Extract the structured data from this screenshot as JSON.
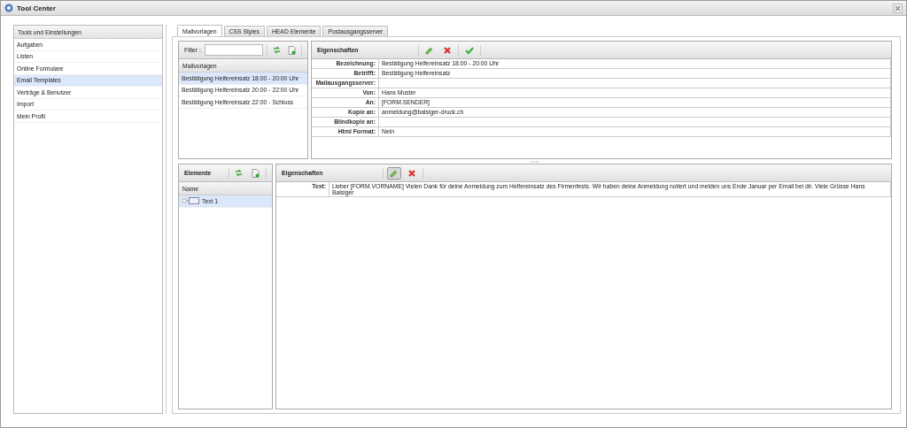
{
  "window": {
    "title": "Tool Center"
  },
  "sidebar": {
    "header": "Tools und Einstellungen",
    "items": [
      {
        "label": "Aufgaben",
        "selected": false
      },
      {
        "label": "Listen",
        "selected": false
      },
      {
        "label": "Online Formulare",
        "selected": false
      },
      {
        "label": "Email Templates",
        "selected": true
      },
      {
        "label": "Verträge & Benutzer",
        "selected": false
      },
      {
        "label": "Import",
        "selected": false
      },
      {
        "label": "Mein Profil",
        "selected": false
      }
    ]
  },
  "tabs": [
    {
      "label": "Mailvorlagen",
      "selected": true
    },
    {
      "label": "CSS Styles",
      "selected": false
    },
    {
      "label": "HEAD Elemente",
      "selected": false
    },
    {
      "label": "Postausgangsserver",
      "selected": false
    }
  ],
  "templates": {
    "filter_label": "Filter :",
    "toolbar": [
      {
        "kind": "refresh"
      },
      {
        "kind": "add"
      }
    ],
    "header": "Mailvorlagen",
    "rows": [
      {
        "label": "Bestätigung Helfereinsatz 18:00 - 20:00 Uhr",
        "selected": true
      },
      {
        "label": "Bestätigung Helfereinsatz 20:00 - 22:00 Uhr",
        "selected": false
      },
      {
        "label": "Bestätigung Helfereinsatz 22:00 - Schluss",
        "selected": false
      }
    ]
  },
  "properties": {
    "title": "Eigenschaften",
    "toolbar": [
      {
        "kind": "edit",
        "pressed": false
      },
      {
        "kind": "delete",
        "pressed": false
      },
      {
        "kind": "save",
        "pressed": false
      }
    ],
    "rows": [
      {
        "label": "Bezeichnung:",
        "value": "Bestätigung Helfereinsatz 18:00 - 20:00 Uhr"
      },
      {
        "label": "Betrifft:",
        "value": "Bestätigung Helfereinsatz"
      },
      {
        "label": "Mailausgangsserver:"
      },
      {
        "label": "Von:",
        "value": "Hans Muster"
      },
      {
        "label": "An:",
        "value": "[FORM.SENDER]"
      },
      {
        "label": "Kopie an:",
        "value": "anmeldung@balsiger-druck.ch"
      },
      {
        "label": "Blindkopie an:"
      },
      {
        "label": "Html Format:",
        "value": "Nein"
      }
    ]
  },
  "elements": {
    "title": "Elemente",
    "toolbar": [
      {
        "kind": "refresh"
      },
      {
        "kind": "add"
      }
    ],
    "column": "Name",
    "items": [
      {
        "label": "Text 1",
        "selected": true
      }
    ]
  },
  "element_properties": {
    "title": "Eigenschaften",
    "toolbar": [
      {
        "kind": "edit",
        "pressed": true
      },
      {
        "kind": "delete",
        "pressed": false
      }
    ],
    "rows": [
      {
        "label": "Text:",
        "value": "Lieber [FORM.VORNAME] Vielen Dank für deine Anmeldung zum Helfereinsatz des Firmenfests. Wir haben deine Anmeldung notiert und melden uns Ende Januar per Email bei dir. Viele Grüsse Hans Balsiger"
      }
    ]
  }
}
